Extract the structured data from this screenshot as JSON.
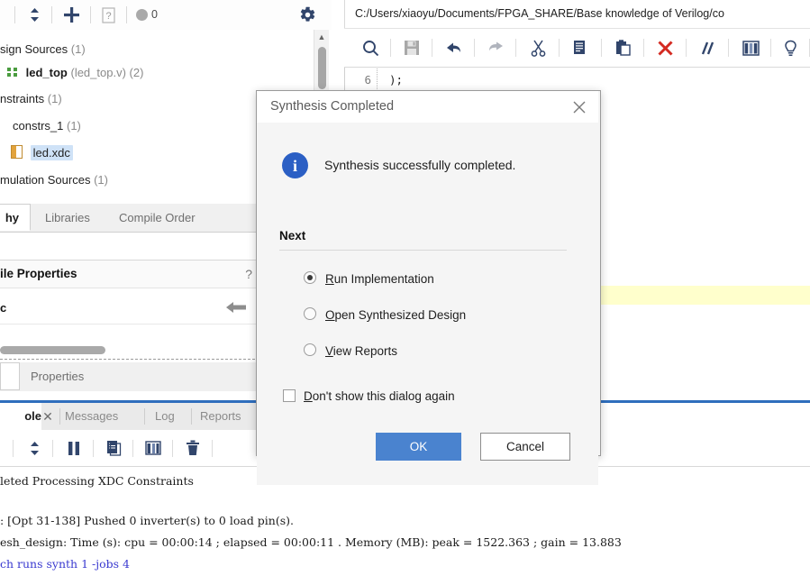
{
  "sources_toolbar": {
    "icons": [
      {
        "name": "collapse-expand-icon",
        "glyph": "updown"
      },
      {
        "name": "add-sources-icon",
        "glyph": "plus"
      },
      {
        "name": "help-document-icon",
        "glyph": "docq"
      },
      {
        "name": "message-count-icon",
        "glyph": "circle"
      },
      {
        "name": "settings-gear-icon",
        "glyph": "gear"
      }
    ],
    "message_count": "0"
  },
  "tree": {
    "rows": [
      {
        "name": "design-sources",
        "text": "sign Sources",
        "count": "(1)",
        "bold": false,
        "indent": 0,
        "icon": "none",
        "selected": false
      },
      {
        "name": "led-top-module",
        "text": "led_top",
        "sub": "(led_top.v)",
        "count": "(2)",
        "bold": true,
        "indent": 12,
        "icon": "module",
        "selected": false
      },
      {
        "name": "constraints-folder",
        "text": "nstraints",
        "count": "(1)",
        "bold": false,
        "indent": 0,
        "icon": "none",
        "selected": false
      },
      {
        "name": "constrs-1-folder",
        "text": "constrs_1",
        "count": "(1)",
        "bold": false,
        "indent": 14,
        "icon": "none",
        "selected": false
      },
      {
        "name": "led-xdc-file",
        "text": "led.xdc",
        "count": "",
        "bold": false,
        "indent": 28,
        "icon": "xdc",
        "selected": true
      },
      {
        "name": "simulation-sources",
        "text": "mulation Sources",
        "count": "(1)",
        "bold": false,
        "indent": 0,
        "icon": "none",
        "selected": false
      }
    ]
  },
  "source_tabs": [
    {
      "name": "tab-hierarchy",
      "label": "hy",
      "active": true
    },
    {
      "name": "tab-libraries",
      "label": "Libraries",
      "active": false
    },
    {
      "name": "tab-compile-order",
      "label": "Compile Order",
      "active": false
    }
  ],
  "file_properties": {
    "title": "ile Properties",
    "help_glyph": "?",
    "minimize_glyph": "—",
    "value": "c",
    "back_icon": "back-arrow-icon"
  },
  "properties_tabs": [
    {
      "name": "tab-properties",
      "label": "Properties",
      "active": false
    }
  ],
  "console_tabs": [
    {
      "name": "tab-tcl-console",
      "label": "ole",
      "active": true
    },
    {
      "name": "tab-messages",
      "label": "Messages",
      "active": false
    },
    {
      "name": "tab-log",
      "label": "Log",
      "active": false
    },
    {
      "name": "tab-reports",
      "label": "Reports",
      "active": false
    }
  ],
  "console_toolbar": {
    "icons": [
      {
        "name": "collapse-expand-icon",
        "glyph": "updown"
      },
      {
        "name": "pause-icon",
        "glyph": "pause"
      },
      {
        "name": "copy-icon",
        "glyph": "copy"
      },
      {
        "name": "table-icon",
        "glyph": "table"
      },
      {
        "name": "clear-trash-icon",
        "glyph": "trash"
      }
    ]
  },
  "console_log": {
    "lines": [
      {
        "text": "leted Processing XDC Constraints",
        "cmd": false
      },
      {
        "text": ": [Opt 31-138] Pushed 0 inverter(s) to 0 load pin(s).",
        "cmd": false
      },
      {
        "text": "esh_design: Time (s): cpu = 00:00:14 ; elapsed = 00:00:11 . Memory (MB): peak = 1522.363 ; gain = 13.883",
        "cmd": false
      },
      {
        "text": "ch runs synth 1 -jobs 4",
        "cmd": true
      }
    ]
  },
  "editor": {
    "path": "C:/Users/xiaoyu/Documents/FPGA_SHARE/Base knowledge of Verilog/co",
    "toolbar_icons": [
      {
        "name": "search-icon",
        "glyph": "search",
        "disabled": false
      },
      {
        "name": "save-icon",
        "glyph": "save",
        "disabled": true
      },
      {
        "name": "undo-icon",
        "glyph": "undo",
        "disabled": false
      },
      {
        "name": "redo-icon",
        "glyph": "redo",
        "disabled": true
      },
      {
        "name": "cut-icon",
        "glyph": "cut",
        "disabled": false
      },
      {
        "name": "copy-icon",
        "glyph": "copy",
        "disabled": false
      },
      {
        "name": "paste-icon",
        "glyph": "paste",
        "disabled": false
      },
      {
        "name": "delete-icon",
        "glyph": "delete",
        "disabled": false
      },
      {
        "name": "comment-icon",
        "glyph": "comment",
        "disabled": false
      },
      {
        "name": "columns-icon",
        "glyph": "columns",
        "disabled": false
      },
      {
        "name": "bulb-icon",
        "glyph": "bulb",
        "disabled": false
      }
    ],
    "code_lines": [
      {
        "no": "6",
        "text": ");"
      }
    ]
  },
  "dialog": {
    "title": "Synthesis Completed",
    "close_icon": "close-icon",
    "info_icon": "info-icon",
    "info_letter": "i",
    "message": "Synthesis successfully completed.",
    "next_label": "Next",
    "options": [
      {
        "name": "radio-run-implementation",
        "mnemonic": "R",
        "rest": "un Implementation",
        "selected": true
      },
      {
        "name": "radio-open-synthesized-design",
        "mnemonic": "O",
        "rest": "pen Synthesized Design",
        "selected": false
      },
      {
        "name": "radio-view-reports",
        "mnemonic": "V",
        "rest": "iew Reports",
        "selected": false
      }
    ],
    "dont_show": {
      "mnemonic": "D",
      "rest": "on't show this dialog again",
      "checked": false
    },
    "ok_label": "OK",
    "cancel_label": "Cancel"
  },
  "colors": {
    "accent_blue": "#2f6ebd",
    "ok_button": "#4a83cf",
    "info_blue": "#2b5fc4",
    "selection": "#cfe2f7",
    "highlight_line": "#ffffcc",
    "delete_red": "#d42a21",
    "command_text": "#3a3ad0"
  }
}
